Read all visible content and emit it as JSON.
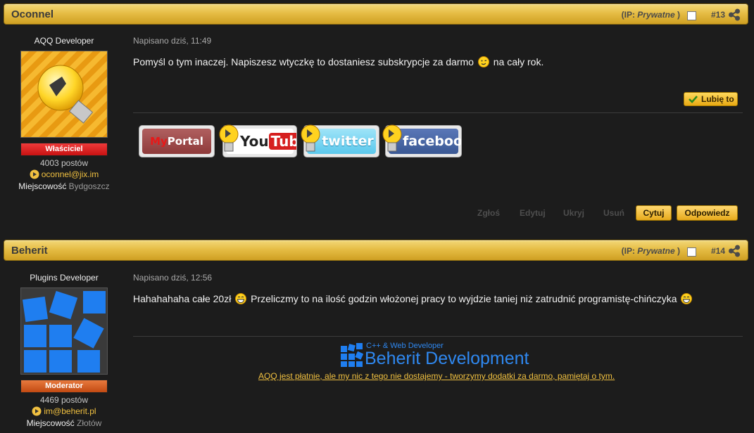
{
  "posts": [
    {
      "author": "Oconnel",
      "ip_label": "(IP:",
      "ip_value": "Prywatne",
      "ip_close": ")",
      "number": "#13",
      "member_title": "AQQ Developer",
      "rank": "Właściciel",
      "rank_color": "#d11a1a",
      "posts_count": "4003 postów",
      "contact": "oconnel@jix.im",
      "location_label": "Miejscowość",
      "location_value": "Bydgoszcz",
      "date": "Napisano dziś, 11:49",
      "body_before": "Pomyśl o tym inaczej. Napiszesz wtyczkę to dostaniesz subskrypcje za darmo",
      "body_emoji": "wink-emoji",
      "body_after": "na cały rok.",
      "like_label": "Lubię to",
      "signature_buttons": [
        {
          "label": "MyPortal",
          "icon": "myportal-badge"
        },
        {
          "label": "YouTube",
          "icon": "youtube-badge"
        },
        {
          "label": "twitter",
          "icon": "twitter-badge"
        },
        {
          "label": "facebook",
          "icon": "facebook-badge"
        }
      ],
      "actions": {
        "report": "Zgłoś",
        "edit": "Edytuj",
        "hide": "Ukryj",
        "delete": "Usuń",
        "quote": "Cytuj",
        "reply": "Odpowiedz"
      }
    },
    {
      "author": "Beherit",
      "ip_label": "(IP:",
      "ip_value": "Prywatne",
      "ip_close": ")",
      "number": "#14",
      "member_title": "Plugins Developer",
      "rank": "Moderator",
      "rank_color": "#d4561a",
      "posts_count": "4469 postów",
      "contact": "im@beherit.pl",
      "location_label": "Miejscowość",
      "location_value": "Złotów",
      "date": "Napisano dziś, 12:56",
      "body_part1": "Hahahahaha całe 20zł",
      "body_part2": "Przeliczmy to na ilość godzin włożonej pracy to wyjdzie taniej niż zatrudnić programistę-chińczyka",
      "body_emoji": "grin-emoji",
      "signature_logo_small": "C++ & Web Developer",
      "signature_logo_big": "Beherit Development",
      "signature_link": "AQQ jest płatnie, ale my nic z tego nie dostajemy - tworzymy dodatki za darmo, pamiętaj o tym."
    }
  ],
  "colors": {
    "header_gold": "#e6bd45",
    "accent_link": "#f0c040",
    "background": "#1c1c1c"
  }
}
